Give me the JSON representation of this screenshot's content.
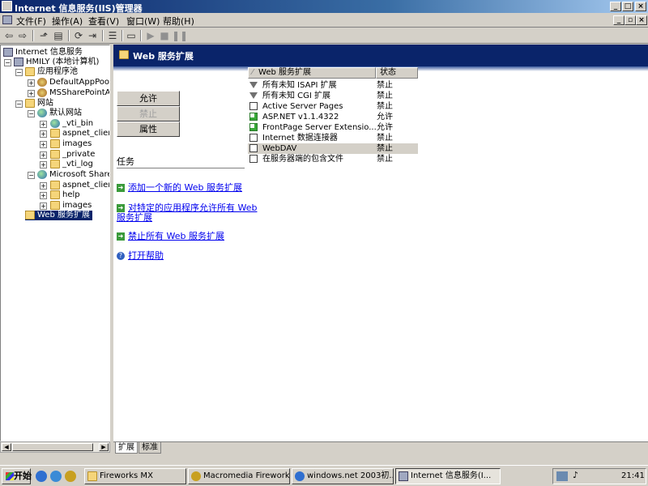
{
  "window": {
    "title": "Internet 信息服务(IIS)管理器"
  },
  "menu": {
    "items": [
      "文件(F)",
      "操作(A)",
      "查看(V)",
      "窗口(W)",
      "帮助(H)"
    ]
  },
  "tree": {
    "root": "Internet 信息服务",
    "computer": "HMILY (本地计算机)",
    "app_pools": "应用程序池",
    "pool_default": "DefaultAppPool",
    "pool_sharepoint": "MSSharePointAppl",
    "websites": "网站",
    "default_site": "默认网站",
    "default_children": [
      "_vti_bin",
      "aspnet_clien",
      "images",
      "_private",
      "_vti_log"
    ],
    "sharepoint_site": "Microsoft ShareI",
    "sharepoint_children": [
      "aspnet_clien",
      "help",
      "images"
    ],
    "web_service_ext": "Web 服务扩展"
  },
  "banner": {
    "title": "Web 服务扩展"
  },
  "actions": {
    "allow": "允许",
    "prohibit": "禁止",
    "properties": "属性"
  },
  "tasks": {
    "label": "任务",
    "add_new_line1": "添加一个新的 Web 服务扩展",
    "allow_all_line1": "对特定的应用程序允许所有 Web",
    "allow_all_line2": "服务扩展",
    "prohibit_all": "禁止所有 Web 服务扩展",
    "open_help": "打开帮助"
  },
  "list": {
    "col_name": "Web 服务扩展",
    "col_status": "状态",
    "rows": [
      {
        "name": "所有未知 ISAPI 扩展",
        "status": "禁止",
        "icon": "filter-icon"
      },
      {
        "name": "所有未知 CGI 扩展",
        "status": "禁止",
        "icon": "filter-icon"
      },
      {
        "name": "Active Server Pages",
        "status": "禁止",
        "icon": "document-icon"
      },
      {
        "name": "ASP.NET v1.1.4322",
        "status": "允许",
        "icon": "document-allowed-icon"
      },
      {
        "name": "FrontPage Server Extensio...",
        "status": "允许",
        "icon": "document-allowed-icon"
      },
      {
        "name": "Internet 数据连接器",
        "status": "禁止",
        "icon": "document-icon"
      },
      {
        "name": "WebDAV",
        "status": "禁止",
        "icon": "document-icon"
      },
      {
        "name": "在服务器端的包含文件",
        "status": "禁止",
        "icon": "document-icon"
      }
    ]
  },
  "bottom_tabs": {
    "extended": "扩展",
    "standard": "标准"
  },
  "taskbar": {
    "start": "开始",
    "buttons": [
      "Fireworks MX",
      "Macromedia Firework...",
      "windows.net 2003初...",
      "Internet 信息服务(I..."
    ],
    "clock": "21:41"
  }
}
